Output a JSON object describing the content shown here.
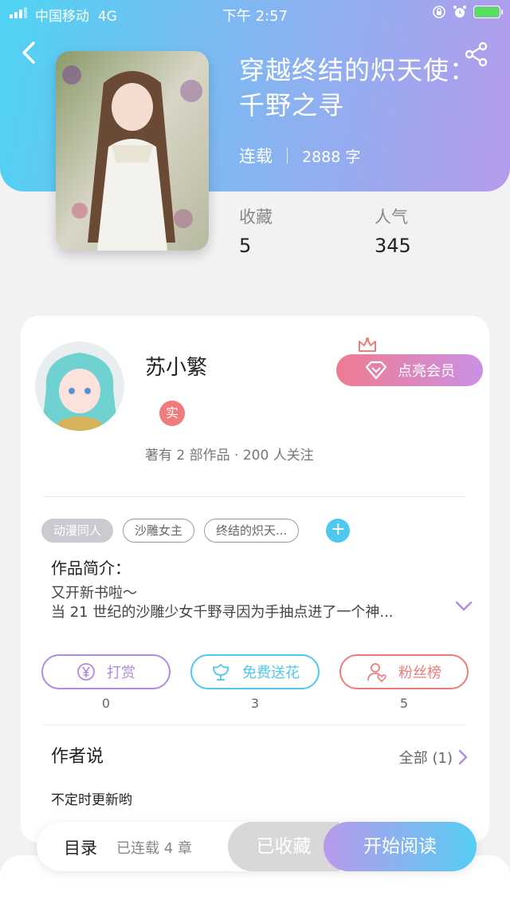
{
  "status_bar": {
    "carrier": "中国移动",
    "network": "4G",
    "time": "下午 2:57"
  },
  "book": {
    "title": "穿越终结的炽天使：千野之寻",
    "status": "连载",
    "words": "2888 字",
    "stats": [
      {
        "label": "收藏",
        "value": "5"
      },
      {
        "label": "人气",
        "value": "345"
      }
    ]
  },
  "author": {
    "name": "苏小繁",
    "badge": "实",
    "info": "著有 2 部作品 · 200 人关注",
    "vip_button": "点亮会员"
  },
  "tags": [
    "动漫同人",
    "沙雕女主",
    "终结的炽天..."
  ],
  "intro": {
    "title": "作品简介：",
    "lines": [
      "又开新书啦～",
      "当 21 世纪的沙雕少女千野寻因为手抽点进了一个神..."
    ]
  },
  "actions": [
    {
      "label": "打赏",
      "count": "0",
      "color": "#b08be0",
      "icon": "yen-icon"
    },
    {
      "label": "免费送花",
      "count": "3",
      "color": "#4fc8ef",
      "icon": "flower-icon"
    },
    {
      "label": "粉丝榜",
      "count": "5",
      "color": "#ef7b7b",
      "icon": "fan-icon"
    }
  ],
  "author_say": {
    "title": "作者说",
    "all_link": "全部 (1)",
    "text": "不定时更新哟"
  },
  "bottom_bar": {
    "toc": "目录",
    "chapters": "已连载 4 章",
    "favorited": "已收藏",
    "read": "开始阅读"
  },
  "colors": {
    "brand_cyan": "#4fd3f3",
    "brand_purple": "#b59bec",
    "vip_pink": "#f07b91"
  }
}
